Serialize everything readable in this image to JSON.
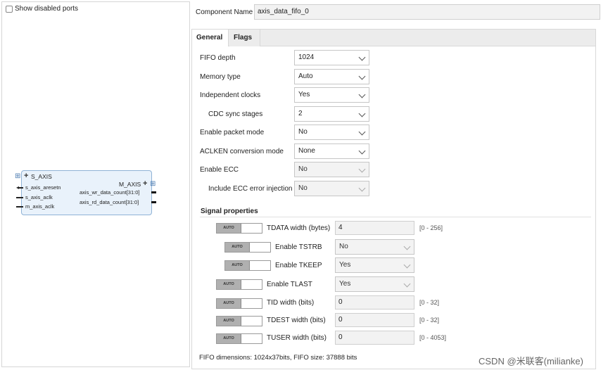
{
  "left": {
    "show_disabled_ports_label": "Show disabled ports",
    "block": {
      "bus_in": "S_AXIS",
      "bus_out": "M_AXIS",
      "ports_in": [
        "s_axis_aresetn",
        "s_axis_aclk",
        "m_axis_aclk"
      ],
      "ports_out": [
        "axis_wr_data_count[31:0]",
        "axis_rd_data_count[31:0]"
      ]
    }
  },
  "component": {
    "label": "Component Name",
    "value": "axis_data_fifo_0"
  },
  "tabs": [
    {
      "label": "General",
      "active": true
    },
    {
      "label": "Flags",
      "active": false
    }
  ],
  "general": {
    "rows": [
      {
        "label": "FIFO depth",
        "value": "1024",
        "disabled": false
      },
      {
        "label": "Memory type",
        "value": "Auto",
        "disabled": false
      },
      {
        "label": "Independent clocks",
        "value": "Yes",
        "disabled": false
      },
      {
        "label": "CDC sync stages",
        "value": "2",
        "disabled": false
      },
      {
        "label": "Enable packet mode",
        "value": "No",
        "disabled": false
      },
      {
        "label": "ACLKEN conversion mode",
        "value": "None",
        "disabled": false
      },
      {
        "label": "Enable ECC",
        "value": "No",
        "disabled": true
      },
      {
        "label": "Include ECC error injection",
        "value": "No",
        "disabled": true
      }
    ]
  },
  "signal": {
    "title": "Signal properties",
    "auto_label": "AUTO",
    "rows": [
      {
        "label": "TDATA width (bytes)",
        "value": "4",
        "range": "[0 - 256]"
      },
      {
        "label": "Enable TSTRB",
        "value": "No"
      },
      {
        "label": "Enable TKEEP",
        "value": "Yes"
      },
      {
        "label": "Enable TLAST",
        "value": "Yes"
      },
      {
        "label": "TID width (bits)",
        "value": "0",
        "range": "[0 - 32]"
      },
      {
        "label": "TDEST width (bits)",
        "value": "0",
        "range": "[0 - 32]"
      },
      {
        "label": "TUSER width (bits)",
        "value": "0",
        "range": "[0 - 4053]"
      }
    ]
  },
  "footer": {
    "fifo_dimensions": "FIFO dimensions: 1024x37bits, FIFO size: 37888 bits"
  },
  "watermark": "CSDN @米联客(milianke)"
}
